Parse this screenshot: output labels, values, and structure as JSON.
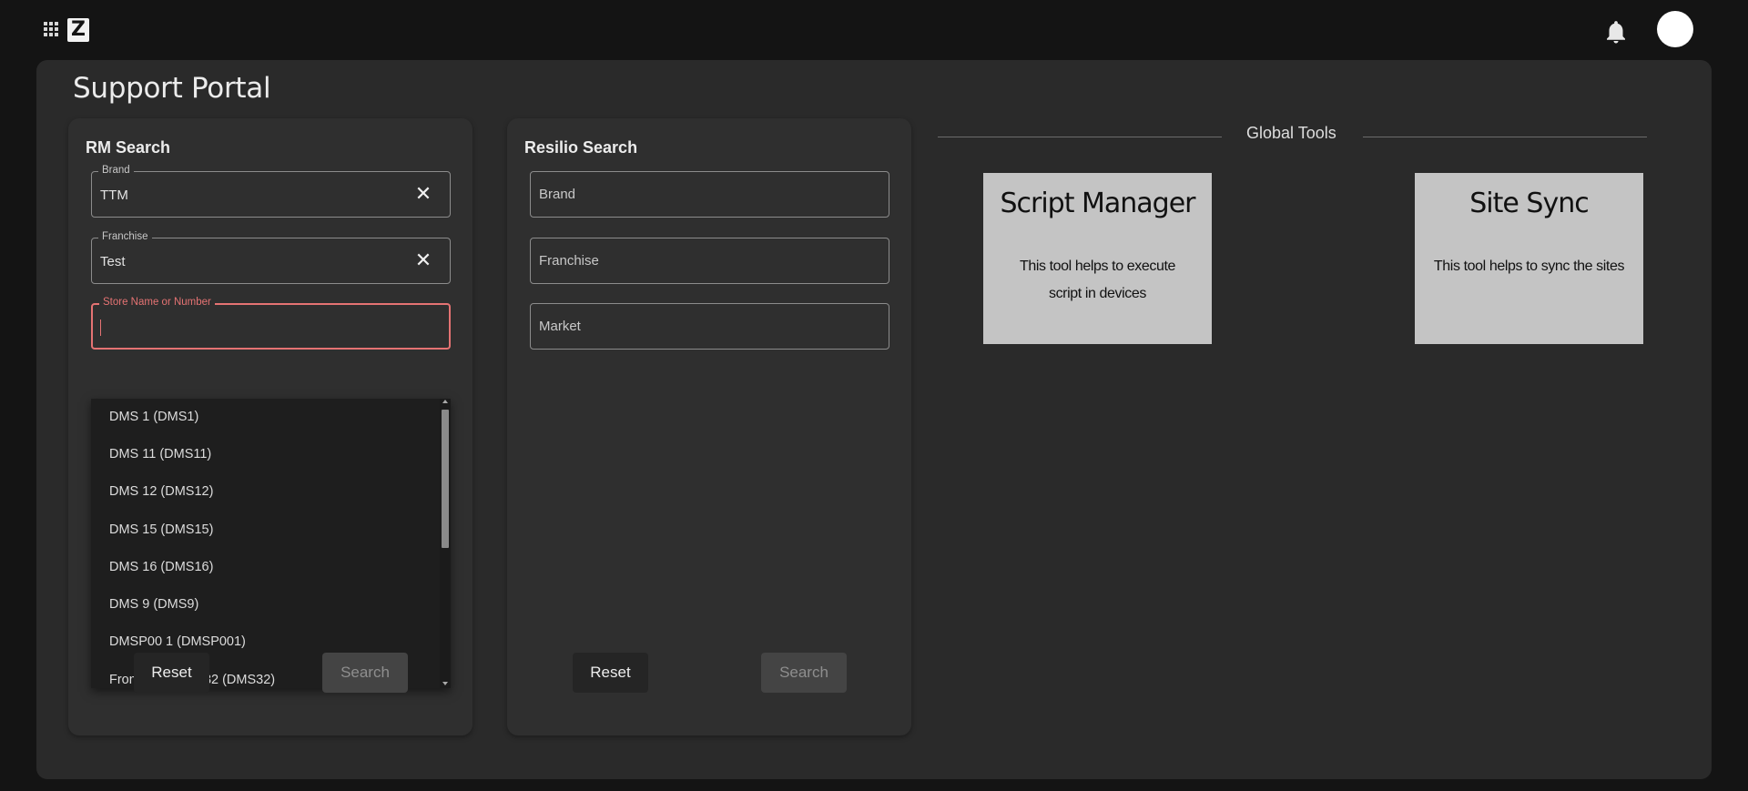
{
  "header": {
    "logo_letter": "Z",
    "icons": [
      "apps-grid-icon",
      "notification-bell-icon",
      "user-avatar"
    ]
  },
  "page": {
    "title": "Support Portal"
  },
  "rm_search": {
    "title": "RM Search",
    "brand": {
      "label": "Brand",
      "value": "TTM"
    },
    "franchise": {
      "label": "Franchise",
      "value": "Test"
    },
    "store": {
      "label": "Store Name or Number",
      "value": ""
    },
    "options": [
      "DMS 1  (DMS1)",
      "DMS 11  (DMS11)",
      "DMS 12  (DMS12)",
      "DMS 15  (DMS15)",
      "DMS 16  (DMS16)",
      "DMS 9  (DMS9)",
      "DMSP00 1  (DMSP001)",
      "Front End DMS 32  (DMS32)"
    ],
    "reset_label": "Reset",
    "search_label": "Search"
  },
  "resilio_search": {
    "title": "Resilio Search",
    "brand_placeholder": "Brand",
    "franchise_placeholder": "Franchise",
    "market_placeholder": "Market",
    "reset_label": "Reset",
    "search_label": "Search"
  },
  "global_tools": {
    "title": "Global Tools",
    "tools": [
      {
        "name": "Script Manager",
        "description": "This tool helps to execute script in devices"
      },
      {
        "name": "Site Sync",
        "description": "This tool helps to sync the sites"
      }
    ]
  },
  "colors": {
    "background": "#141414",
    "panel": "#2a2a2a",
    "card": "#2f2f2f",
    "focus_accent": "#e57373",
    "tool_card": "#c4c4c4"
  }
}
